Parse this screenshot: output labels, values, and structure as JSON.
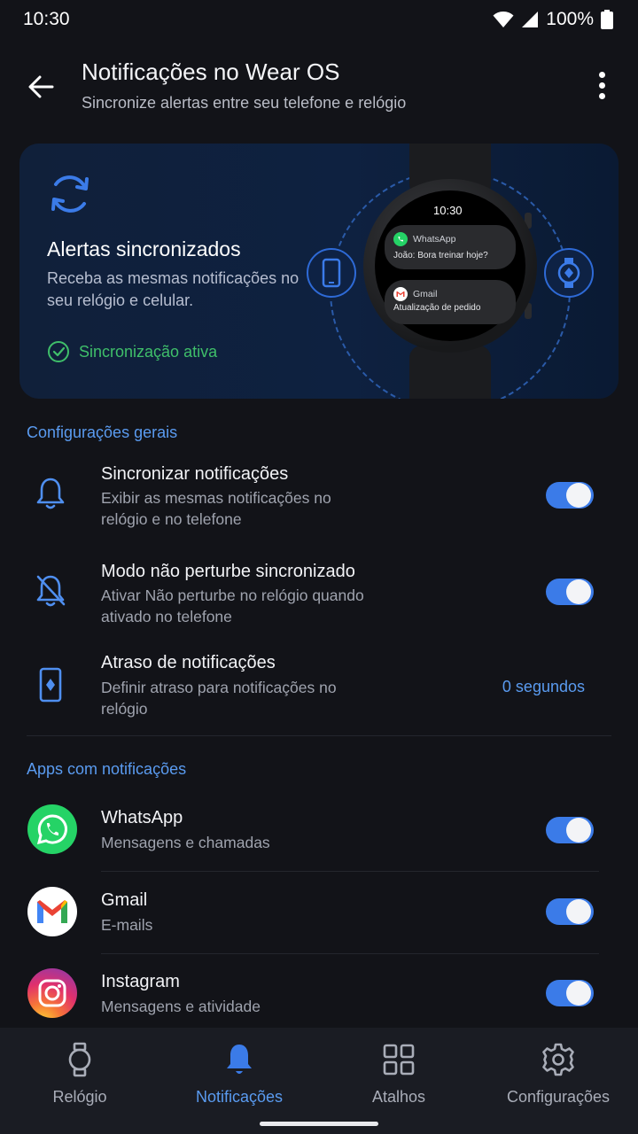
{
  "status": {
    "time": "10:30",
    "battery": "100%"
  },
  "header": {
    "title": "Notificações no Wear OS",
    "subtitle": "Sincronize alertas entre seu telefone e relógio"
  },
  "hero": {
    "title": "Alertas sincronizados",
    "description": "Receba as mesmas notificações no seu relógio e celular.",
    "status": "Sincronização ativa",
    "watch": {
      "time": "10:30",
      "cards": [
        {
          "app": "WhatsApp",
          "text": "João: Bora treinar hoje?"
        },
        {
          "app": "Gmail",
          "text": "Atualização de pedido"
        }
      ]
    }
  },
  "general": {
    "label": "Configurações gerais",
    "items": [
      {
        "title": "Sincronizar notificações",
        "desc": "Exibir as mesmas notificações no relógio e no telefone",
        "on": true
      },
      {
        "title": "Modo não perturbe sincronizado",
        "desc": "Ativar Não perturbe no relógio quando ativado no telefone",
        "on": true
      },
      {
        "title": "Atraso de notificações",
        "desc": "Definir atraso para notificações no relógio",
        "value": "0 segundos"
      }
    ]
  },
  "apps": {
    "label": "Apps com notificações",
    "items": [
      {
        "name": "WhatsApp",
        "desc": "Mensagens e chamadas",
        "on": true
      },
      {
        "name": "Gmail",
        "desc": "E-mails",
        "on": true
      },
      {
        "name": "Instagram",
        "desc": "Mensagens e atividade",
        "on": true
      }
    ]
  },
  "nav": {
    "items": [
      {
        "label": "Relógio"
      },
      {
        "label": "Notificações"
      },
      {
        "label": "Atalhos"
      },
      {
        "label": "Configurações"
      }
    ],
    "active": 1
  },
  "colors": {
    "accent": "#3B7BE8",
    "accent_text": "#5A9BF0",
    "success": "#3FBF6A",
    "background": "#121318"
  }
}
